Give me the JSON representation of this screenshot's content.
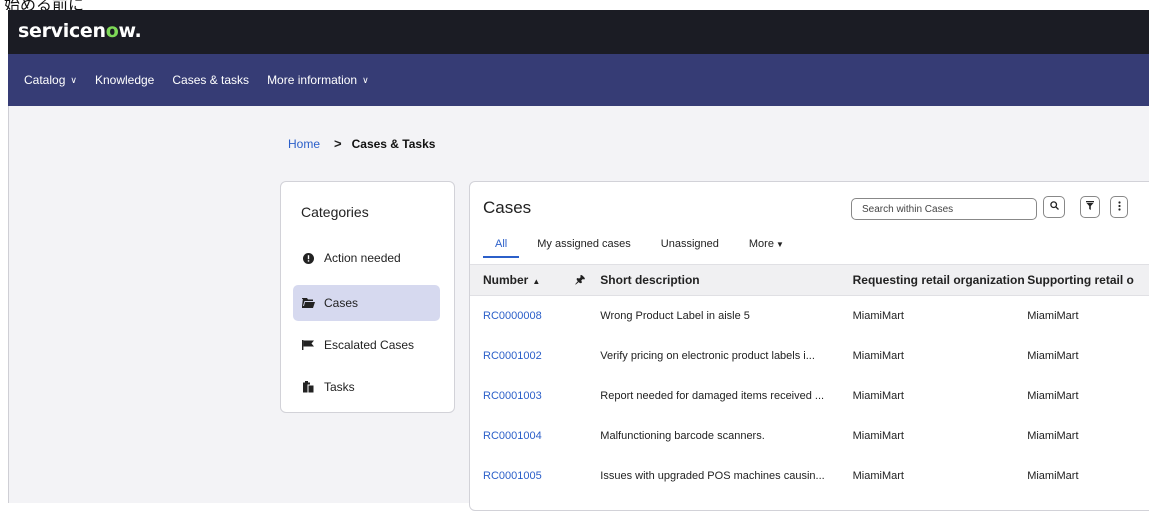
{
  "caption": "始める前に",
  "app": {
    "logo_main": "servicen",
    "logo_accent": "o",
    "logo_end": "w."
  },
  "nav": {
    "items": [
      {
        "label": "Catalog",
        "chevron": true
      },
      {
        "label": "Knowledge",
        "chevron": false
      },
      {
        "label": "Cases & tasks",
        "chevron": false
      },
      {
        "label": "More information",
        "chevron": true
      }
    ]
  },
  "breadcrumb": {
    "home": "Home",
    "separator": ">",
    "current": "Cases & Tasks"
  },
  "categories": {
    "title": "Categories",
    "items": [
      {
        "label": "Action needed",
        "icon": "alert-circle-icon",
        "active": false
      },
      {
        "label": "Cases",
        "icon": "folder-icon",
        "active": true
      },
      {
        "label": "Escalated Cases",
        "icon": "flag-icon",
        "active": false
      },
      {
        "label": "Tasks",
        "icon": "clipboard-icon",
        "active": false
      }
    ]
  },
  "cases": {
    "title": "Cases",
    "search_placeholder": "Search within Cases",
    "tabs": [
      "All",
      "My assigned cases",
      "Unassigned",
      "More"
    ],
    "active_tab": "All",
    "columns": {
      "number": "Number",
      "description": "Short description",
      "org": "Requesting retail organization",
      "supporting": "Supporting retail o"
    },
    "rows": [
      {
        "number": "RC0000008",
        "description": "Wrong Product Label in aisle 5",
        "org": "MiamiMart",
        "supporting": "MiamiMart"
      },
      {
        "number": "RC0001002",
        "description": "Verify pricing on electronic product labels i...",
        "org": "MiamiMart",
        "supporting": "MiamiMart"
      },
      {
        "number": "RC0001003",
        "description": "Report needed for damaged items received ...",
        "org": "MiamiMart",
        "supporting": "MiamiMart"
      },
      {
        "number": "RC0001004",
        "description": "Malfunctioning barcode scanners.",
        "org": "MiamiMart",
        "supporting": "MiamiMart"
      },
      {
        "number": "RC0001005",
        "description": "Issues with upgraded POS machines causin...",
        "org": "MiamiMart",
        "supporting": "MiamiMart"
      }
    ]
  },
  "colors": {
    "logo_bar": "#1b1c24",
    "nav_bar": "#363c75",
    "link": "#2b5fc9",
    "active_category": "#d6d9ef",
    "logo_accent": "#7ed957"
  }
}
